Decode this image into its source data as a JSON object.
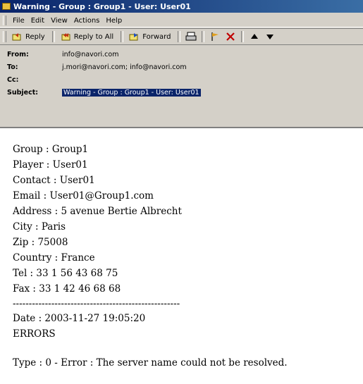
{
  "window": {
    "title": "Warning - Group : Group1 - User: User01"
  },
  "menu": {
    "items": [
      "File",
      "Edit",
      "View",
      "Actions",
      "Help"
    ]
  },
  "toolbar": {
    "reply_label": "Reply",
    "reply_all_label": "Reply to All",
    "forward_label": "Forward",
    "icons": [
      "reply-icon",
      "reply-all-icon",
      "forward-icon",
      "print-icon",
      "flag-icon",
      "delete-icon",
      "previous-icon",
      "next-icon"
    ]
  },
  "headers": {
    "from_label": "From:",
    "from_value": "info@navori.com",
    "to_label": "To:",
    "to_value": "j.mori@navori.com; info@navori.com",
    "cc_label": "Cc:",
    "cc_value": "",
    "subject_label": "Subject:",
    "subject_value": "Warning - Group : Group1 - User: User01"
  },
  "body": {
    "lines": [
      "Group : Group1",
      "Player : User01",
      "Contact : User01",
      "Email : User01@Group1.com",
      "Address : 5 avenue Bertie Albrecht",
      "City : Paris",
      "Zip : 75008",
      "Country : France",
      "Tel : 33 1 56 43 68 75",
      "Fax : 33 1 42 46 68 68",
      "----------------------------------------------------",
      "Date : 2003-11-27 19:05:20",
      "ERRORS",
      "Type : 0 - Error : The server name could not be resolved."
    ]
  },
  "colors": {
    "titlebar": "#0a246a",
    "selection": "#0a246a",
    "chrome": "#d4d0c8"
  }
}
